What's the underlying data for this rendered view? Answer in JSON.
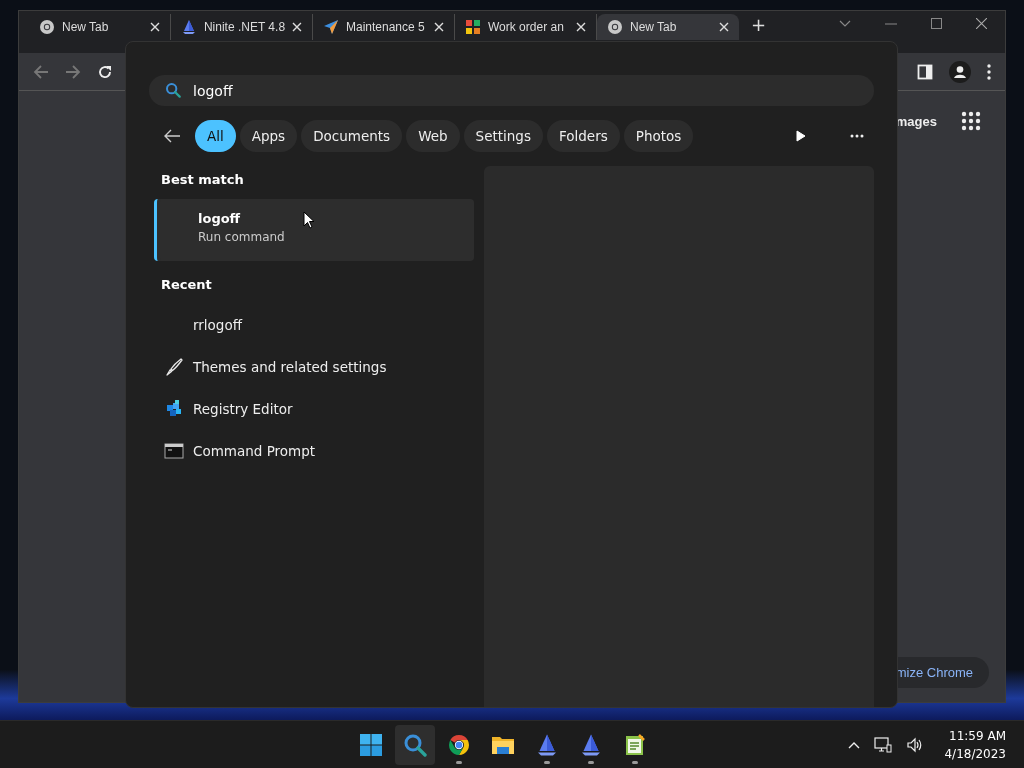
{
  "browser": {
    "tabs": [
      {
        "title": "New Tab",
        "kind": "chrome",
        "selected": false
      },
      {
        "title": "Ninite .NET 4.8",
        "kind": "sail",
        "selected": false
      },
      {
        "title": "Maintenance 5",
        "kind": "plane",
        "selected": false
      },
      {
        "title": "Work order an",
        "kind": "puzzle",
        "selected": false
      },
      {
        "title": "New Tab",
        "kind": "chrome",
        "selected": true
      }
    ],
    "new_tab": "+",
    "page": {
      "images_link": "mages",
      "customize_button": "mize Chrome"
    }
  },
  "search_flyout": {
    "query": "logoff",
    "filters": [
      {
        "label": "All",
        "selected": true
      },
      {
        "label": "Apps",
        "selected": false
      },
      {
        "label": "Documents",
        "selected": false
      },
      {
        "label": "Web",
        "selected": false
      },
      {
        "label": "Settings",
        "selected": false
      },
      {
        "label": "Folders",
        "selected": false
      },
      {
        "label": "Photos",
        "selected": false
      }
    ],
    "best_match_heading": "Best match",
    "best_match": {
      "title": "logoff",
      "subtitle": "Run command",
      "selected": true
    },
    "recent_heading": "Recent",
    "recent": [
      {
        "label": "rrlogoff",
        "kind": "none"
      },
      {
        "label": "Themes and related settings",
        "kind": "brush"
      },
      {
        "label": "Registry Editor",
        "kind": "registry"
      },
      {
        "label": "Command Prompt",
        "kind": "console"
      }
    ]
  },
  "taskbar": {
    "apps": [
      {
        "kind": "start",
        "active": false,
        "running": false
      },
      {
        "kind": "search",
        "active": true,
        "running": false
      },
      {
        "kind": "chrome",
        "active": false,
        "running": true
      },
      {
        "kind": "folder",
        "active": false,
        "running": false
      },
      {
        "kind": "sail",
        "active": false,
        "running": true
      },
      {
        "kind": "sail",
        "active": false,
        "running": true
      },
      {
        "kind": "notepad",
        "active": false,
        "running": true
      }
    ],
    "time": "11:59 AM",
    "date": "4/18/2023"
  }
}
